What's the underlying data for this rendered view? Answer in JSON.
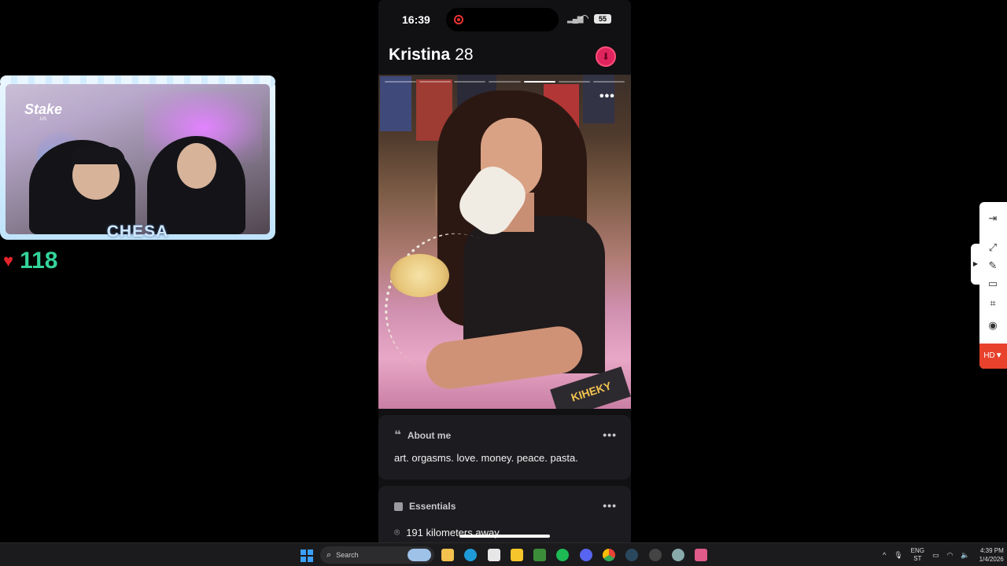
{
  "webcam": {
    "brand": "Stake",
    "brand_sub": ".US",
    "streamer_name": "CHESA"
  },
  "likes": {
    "count": "118",
    "icon": "heart-icon"
  },
  "phone": {
    "status": {
      "time": "16:39",
      "battery": "55",
      "signal_icon": "signal-icon",
      "wifi_icon": "wifi-icon"
    },
    "profile": {
      "name": "Kristina",
      "age": "28"
    },
    "photo": {
      "total_photos": 7,
      "active_photo": 5,
      "magazine_text": "KIHEKY"
    },
    "about": {
      "title": "About me",
      "bio": "art. orgasms. love. money. peace. pasta."
    },
    "essentials": {
      "title": "Essentials",
      "distance": "191 kilometers away"
    }
  },
  "side_toolbar": {
    "hd_label": "HD▼"
  },
  "taskbar": {
    "search_label": "Search",
    "language": "ENG",
    "region": "ST",
    "time": "4:39 PM",
    "date": "1/4/2026",
    "accent": "#3aa0ff"
  }
}
